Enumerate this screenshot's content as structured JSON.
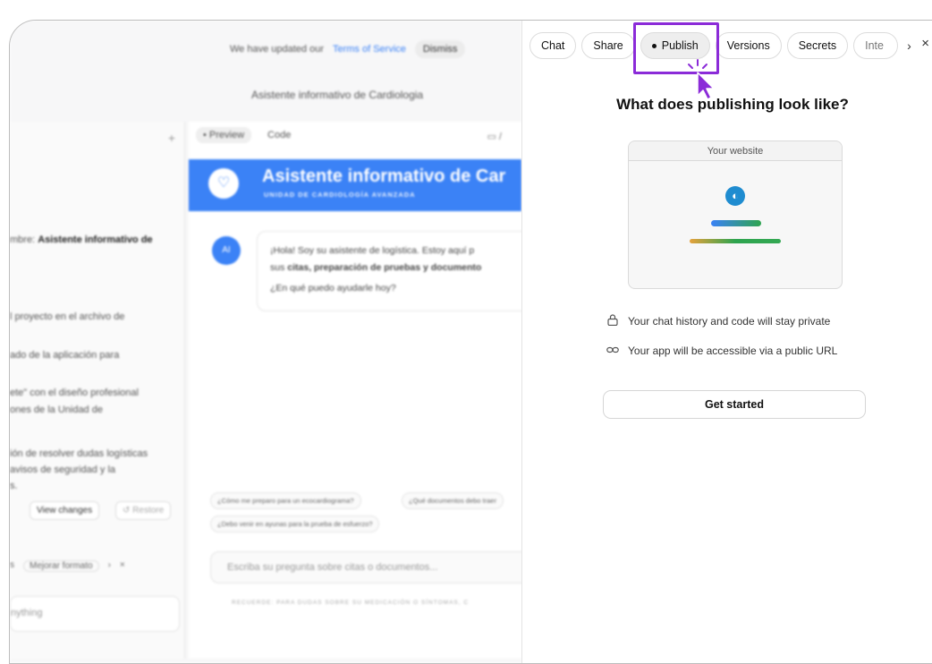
{
  "notice": {
    "text": "We have updated our",
    "link": "Terms of Service",
    "dismiss": "Dismiss"
  },
  "app_title": "Asistente informativo de Cardiologia",
  "sidebar": {
    "lines": [
      {
        "prefix": "mbre: ",
        "bold": "Asistente informativo de"
      },
      {
        "prefix": "l proyecto en el archivo de",
        "bold": ""
      },
      {
        "prefix": "ado de la aplicación para",
        "bold": ""
      },
      {
        "prefix": "ete\" con el diseño profesional",
        "bold": ""
      },
      {
        "prefix": "ones de la Unidad de",
        "bold": ""
      },
      {
        "prefix": "ión de resolver dudas logísticas",
        "bold": ""
      },
      {
        "prefix": "avisos de seguridad y la",
        "bold": ""
      },
      {
        "prefix": "s.",
        "bold": ""
      }
    ],
    "view_changes": "View changes",
    "restore": "↺ Restore",
    "footer": [
      "s",
      "Mejorar formato",
      "›",
      "×"
    ],
    "input_placeholder": "nything"
  },
  "preview": {
    "tabs": [
      "• Preview",
      "Code"
    ],
    "banner_title": "Asistente informativo de Car",
    "banner_subtitle": "UNIDAD DE CARDIOLOGÍA AVANZADA",
    "ai_label": "AI",
    "message_line1": "¡Hola! Soy su asistente de logística. Estoy aquí p",
    "message_line2_a": "sus ",
    "message_line2_b": "citas, preparación de pruebas y documento",
    "message_line3": "¿En qué puedo ayudarle hoy?",
    "suggestions": [
      "¿Cómo me preparo para un ecocardiograma?",
      "¿Qué documentos debo traer",
      "¿Debo venir en ayunas para la prueba de esfuerzo?"
    ],
    "chat_placeholder": "Escriba su pregunta sobre citas o documentos...",
    "disclaimer": "RECUERDE: PARA DUDAS SOBRE SU MEDICACIÓN O SÍNTOMAS, C"
  },
  "panel": {
    "tabs": [
      "Chat",
      "Share",
      "Publish",
      "Versions",
      "Secrets",
      "Inte"
    ],
    "active_tab": "Publish",
    "next_arrow": "›",
    "close": "×",
    "heading": "What does publishing look like?",
    "website_label": "Your website",
    "info": [
      {
        "icon": "lock-icon",
        "text": "Your chat history and code will stay private"
      },
      {
        "icon": "link-icon",
        "text": "Your app will be accessible via a public URL"
      }
    ],
    "cta": "Get started"
  },
  "colors": {
    "highlight": "#8b2bd8",
    "brand_blue": "#3b82f6"
  }
}
